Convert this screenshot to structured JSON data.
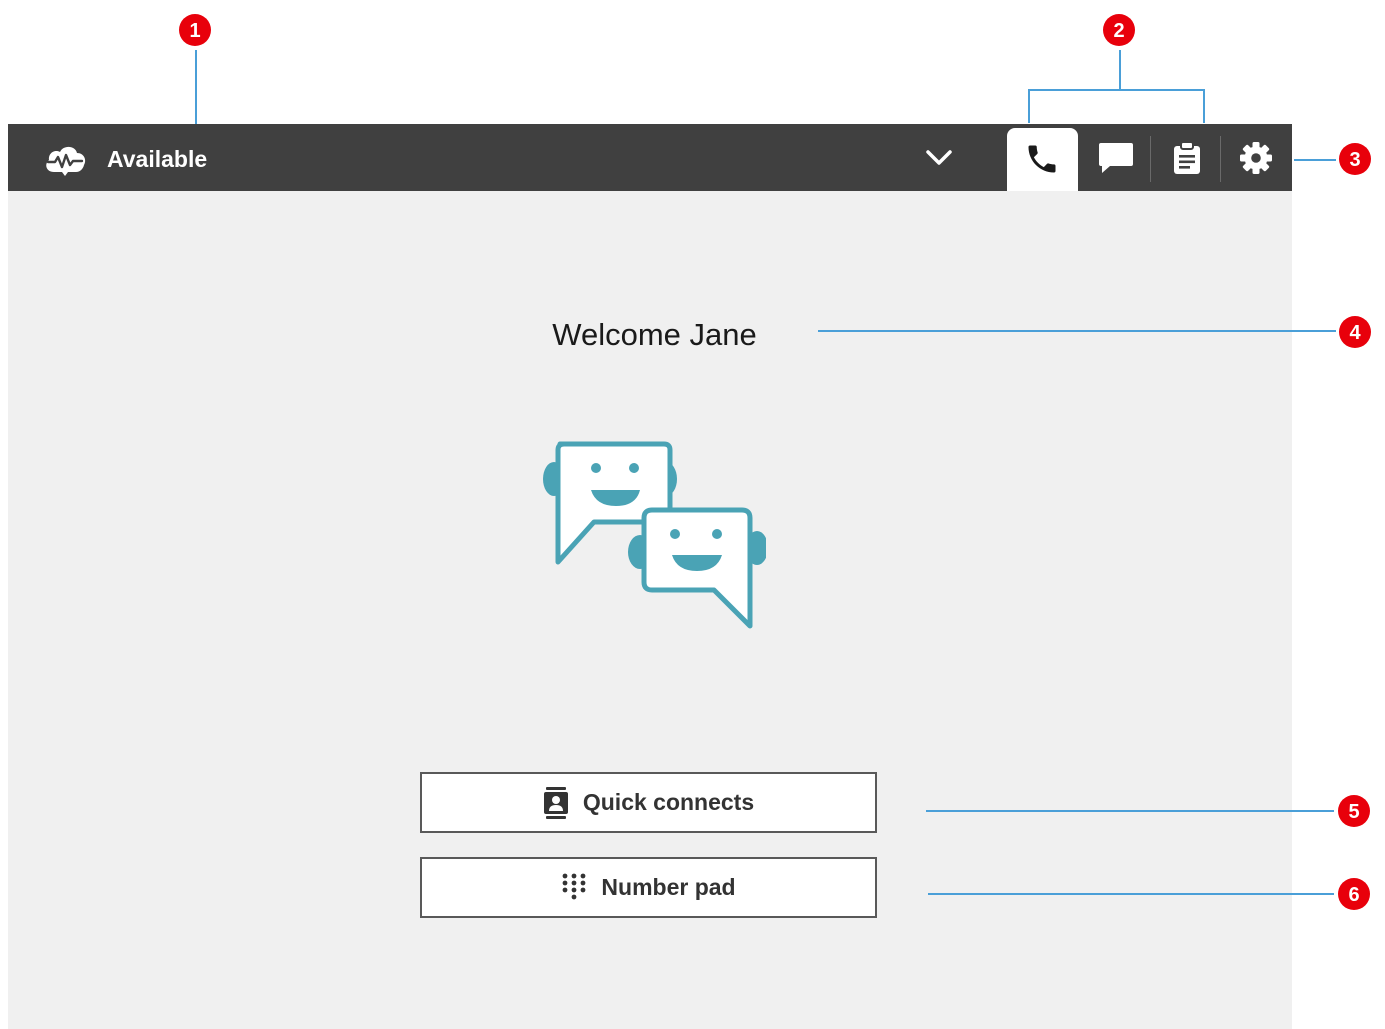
{
  "status": {
    "label": "Available",
    "icon": "cloud-status-icon"
  },
  "tabs": [
    {
      "name": "calls",
      "icon": "phone-icon",
      "active": true
    },
    {
      "name": "chats",
      "icon": "chat-icon",
      "active": false
    },
    {
      "name": "tasks",
      "icon": "clipboard-icon",
      "active": false
    },
    {
      "name": "settings",
      "icon": "gear-icon",
      "active": false
    }
  ],
  "main": {
    "welcome": "Welcome Jane",
    "quick_connects_label": "Quick connects",
    "number_pad_label": "Number pad"
  },
  "callouts": [
    "1",
    "2",
    "3",
    "4",
    "5",
    "6"
  ],
  "colors": {
    "topbar": "#404040",
    "background": "#f0f0f0",
    "accent_teal": "#4aa3b5",
    "callout_red": "#e8000b",
    "callout_line": "#4a9fd8"
  }
}
